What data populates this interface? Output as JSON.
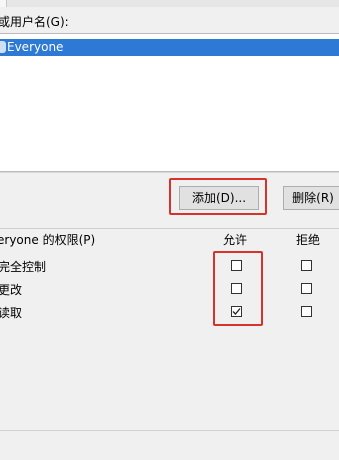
{
  "group_label": "或用户名(G):",
  "users": [
    {
      "name": "Everyone",
      "selected": true
    }
  ],
  "buttons": {
    "add": "添加(D)...",
    "remove": "删除(R)"
  },
  "permissions": {
    "title": "eryone 的权限(P)",
    "allow_header": "允许",
    "deny_header": "拒绝",
    "rows": [
      {
        "label": "完全控制",
        "allow": false,
        "deny": false
      },
      {
        "label": "更改",
        "allow": false,
        "deny": false
      },
      {
        "label": "读取",
        "allow": true,
        "deny": false
      }
    ]
  },
  "colors": {
    "selection": "#2d7ad6",
    "highlight_box": "#d7322c"
  }
}
